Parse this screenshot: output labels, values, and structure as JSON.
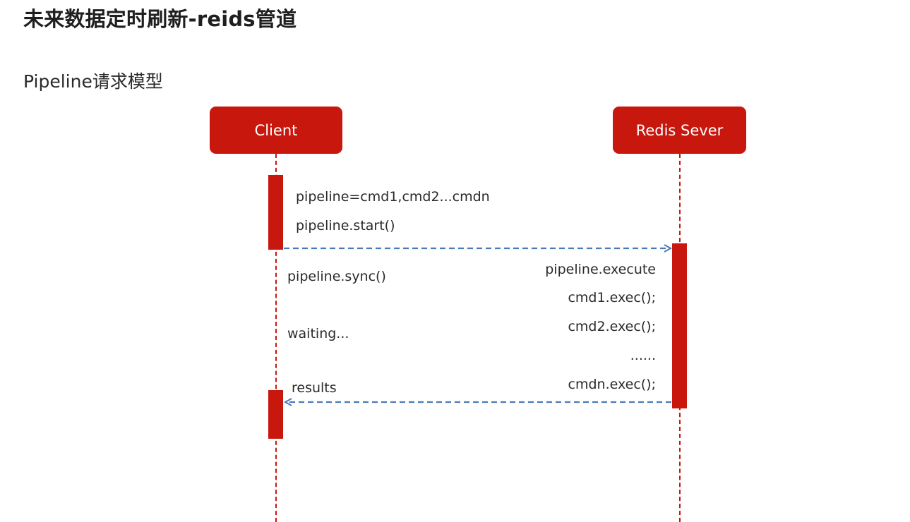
{
  "slide": {
    "title": "未来数据定时刷新-reids管道",
    "subtitle": "Pipeline请求模型"
  },
  "actors": {
    "client": "Client",
    "server": "Redis Sever"
  },
  "client_notes": {
    "pipeline_def": "pipeline=cmd1,cmd2...cmdn",
    "pipeline_start": "pipeline.start()",
    "pipeline_sync": "pipeline.sync()",
    "waiting": "waiting..."
  },
  "server_notes": {
    "execute": "pipeline.execute",
    "cmd1": "cmd1.exec();",
    "cmd2": "cmd2.exec();",
    "ellipsis": "......",
    "cmdn": "cmdn.exec();"
  },
  "messages": {
    "results": "results"
  },
  "colors": {
    "actor": "#c8170d",
    "lifeline": "#c8170d",
    "arrow": "#4a7ab8"
  }
}
